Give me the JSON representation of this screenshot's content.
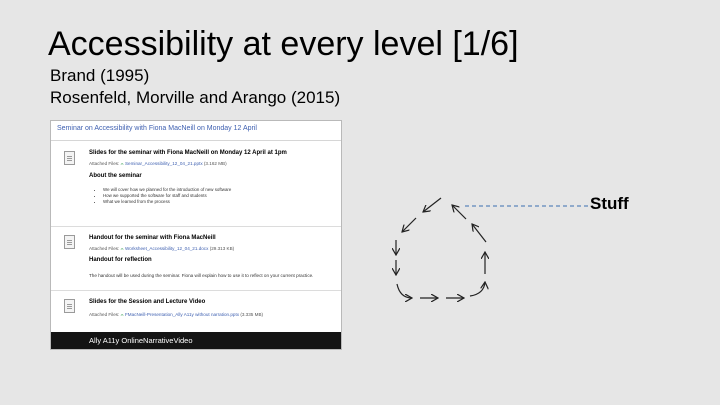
{
  "slide": {
    "title": "Accessibility at every level [1/6]",
    "subtitle_1": "Brand (1995)",
    "subtitle_2": "Rosenfeld, Morville and Arango (2015)",
    "label": "Stuff"
  },
  "screenshot": {
    "header": "Seminar on Accessibility with Fiona MacNeill on Monday 12 April",
    "attached_label": "Attached Files:",
    "items": [
      {
        "title": "Slides for the seminar with Fiona MacNeill on Monday 12 April at 1pm",
        "file": "Seminar_Accessibility_12_04_21.pptx",
        "size": "(3.162 MB)",
        "subheading": "About the seminar",
        "bullets": [
          "We will cover how we planned for the introduction of new software",
          "How we supported the software for staff and students",
          "What we learned from the process"
        ]
      },
      {
        "title": "Handout for the seminar with Fiona MacNeill",
        "file": "Worksheet_Accessibility_12_04_21.docx",
        "size": "(29.313 KB)",
        "subheading": "Handout for reflection",
        "text": "The handout will be used during the seminar. Fiona will explain how to use it to reflect on your current practice."
      },
      {
        "title": "Slides for the Session and Lecture Video",
        "file": "FMacNeill-Presentation_Ally A11y without narration.pptx",
        "size": "(3.335 MB)"
      }
    ],
    "video_label": "Ally A11y OnlineNarrativeVideo"
  }
}
